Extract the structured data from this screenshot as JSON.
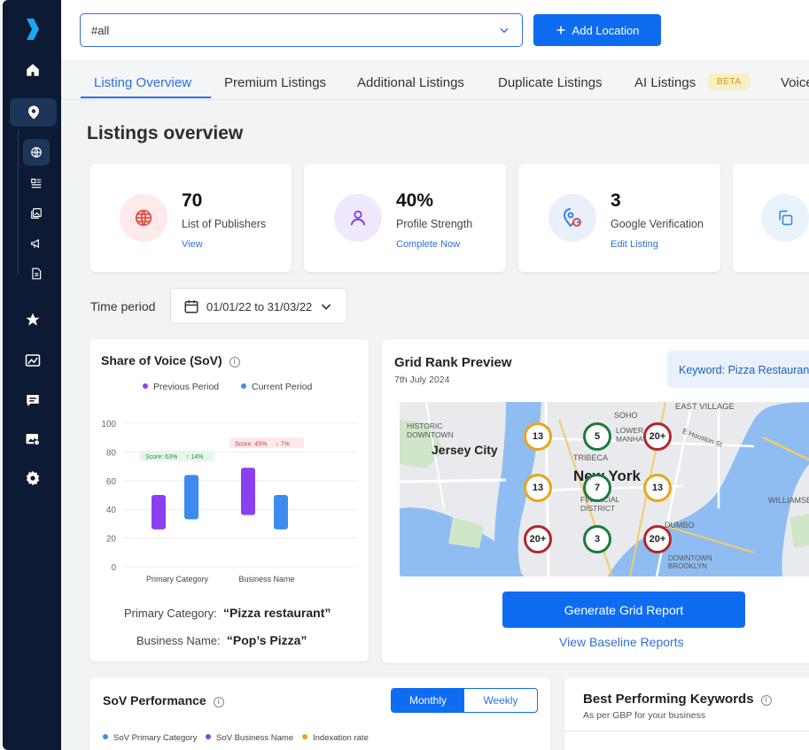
{
  "topbar": {
    "location_value": "#all",
    "add_location_label": "Add Location"
  },
  "tabs": [
    {
      "label": "Listing Overview"
    },
    {
      "label": "Premium Listings"
    },
    {
      "label": "Additional Listings"
    },
    {
      "label": "Duplicate Listings"
    },
    {
      "label": "AI Listings"
    },
    {
      "label": "Voice"
    }
  ],
  "beta_badge": "BETA",
  "page_title": "Listings overview",
  "stats": [
    {
      "value": "70",
      "label": "List of Publishers",
      "link": "View"
    },
    {
      "value": "40%",
      "label": "Profile Strength",
      "link": "Complete Now"
    },
    {
      "value": "3",
      "label": "Google Verification",
      "link": "Edit Listing"
    }
  ],
  "time_period": {
    "label": "Time period",
    "range": "01/01/22 to 31/03/22"
  },
  "sov": {
    "title": "Share of Voice (SoV)",
    "primary_category_label": "Primary Category:",
    "primary_category_value": "“Pizza restaurant”",
    "business_name_label": "Business Name:",
    "business_name_value": "“Pop’s Pizza”"
  },
  "chart_data": {
    "type": "bar",
    "categories": [
      "Primary Category",
      "Business Name"
    ],
    "series": [
      {
        "name": "Previous Period",
        "ranges": [
          [
            26,
            50
          ],
          [
            36,
            69
          ]
        ]
      },
      {
        "name": "Current Period",
        "ranges": [
          [
            33,
            64
          ],
          [
            26,
            50
          ]
        ]
      }
    ],
    "ylim": [
      0,
      100
    ],
    "yticks": [
      "0",
      "20",
      "40",
      "60",
      "80",
      "100"
    ],
    "annotations": [
      {
        "category": "Primary Category",
        "score": "Score: 63%",
        "change": "↑ 14%"
      },
      {
        "category": "Business Name",
        "score": "Score: 45%",
        "change": "↓ 7%"
      }
    ],
    "colors": {
      "previous": "#8b3ff0",
      "current": "#3d8bef"
    }
  },
  "grid": {
    "title": "Grid Rank Preview",
    "date": "7th July 2024",
    "keyword": "Keyword: Pizza Restaurant",
    "generate_label": "Generate Grid Report",
    "baseline_label": "View Baseline Reports",
    "map_labels": [
      "Jersey City",
      "New York",
      "SOHO",
      "EAST VILLAGE",
      "HISTORIC DOWNTOWN",
      "TRIBECA",
      "FINANCIAL DISTRICT",
      "DUMBO",
      "DOWNTOWN BROOKLYN",
      "WILLIAMSBURG",
      "LOWER MANHATTAN",
      "E Houston St"
    ],
    "pins": [
      {
        "rank": "13",
        "status": "medium"
      },
      {
        "rank": "5",
        "status": "good"
      },
      {
        "rank": "20+",
        "status": "poor"
      },
      {
        "rank": "13",
        "status": "medium"
      },
      {
        "rank": "7",
        "status": "good"
      },
      {
        "rank": "13",
        "status": "medium"
      },
      {
        "rank": "20+",
        "status": "poor"
      },
      {
        "rank": "3",
        "status": "good"
      },
      {
        "rank": "20+",
        "status": "poor"
      }
    ],
    "pin_colors": {
      "good": "#1e7a3c",
      "medium": "#e9a51a",
      "poor": "#b3262e"
    }
  },
  "sov_performance": {
    "title": "SoV Performance",
    "toggle": [
      "Monthly",
      "Weekly"
    ],
    "legend": [
      {
        "label": "SoV Primary Category",
        "color": "#3d8bef"
      },
      {
        "label": "SoV Business Name",
        "color": "#8b3ff0"
      },
      {
        "label": "Indexation rate",
        "color": "#f0a020"
      }
    ]
  },
  "keywords": {
    "title": "Best Performing Keywords",
    "subtitle": "As per GBP for your business"
  }
}
